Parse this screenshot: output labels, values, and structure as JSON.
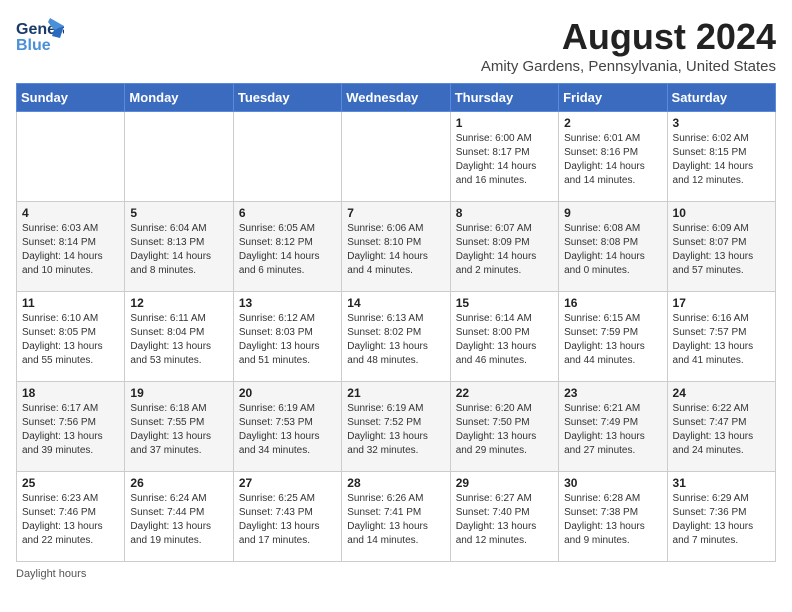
{
  "logo": {
    "general": "General",
    "blue": "Blue"
  },
  "title": "August 2024",
  "subtitle": "Amity Gardens, Pennsylvania, United States",
  "days_of_week": [
    "Sunday",
    "Monday",
    "Tuesday",
    "Wednesday",
    "Thursday",
    "Friday",
    "Saturday"
  ],
  "weeks": [
    [
      {
        "day": "",
        "info": ""
      },
      {
        "day": "",
        "info": ""
      },
      {
        "day": "",
        "info": ""
      },
      {
        "day": "",
        "info": ""
      },
      {
        "day": "1",
        "info": "Sunrise: 6:00 AM\nSunset: 8:17 PM\nDaylight: 14 hours\nand 16 minutes."
      },
      {
        "day": "2",
        "info": "Sunrise: 6:01 AM\nSunset: 8:16 PM\nDaylight: 14 hours\nand 14 minutes."
      },
      {
        "day": "3",
        "info": "Sunrise: 6:02 AM\nSunset: 8:15 PM\nDaylight: 14 hours\nand 12 minutes."
      }
    ],
    [
      {
        "day": "4",
        "info": "Sunrise: 6:03 AM\nSunset: 8:14 PM\nDaylight: 14 hours\nand 10 minutes."
      },
      {
        "day": "5",
        "info": "Sunrise: 6:04 AM\nSunset: 8:13 PM\nDaylight: 14 hours\nand 8 minutes."
      },
      {
        "day": "6",
        "info": "Sunrise: 6:05 AM\nSunset: 8:12 PM\nDaylight: 14 hours\nand 6 minutes."
      },
      {
        "day": "7",
        "info": "Sunrise: 6:06 AM\nSunset: 8:10 PM\nDaylight: 14 hours\nand 4 minutes."
      },
      {
        "day": "8",
        "info": "Sunrise: 6:07 AM\nSunset: 8:09 PM\nDaylight: 14 hours\nand 2 minutes."
      },
      {
        "day": "9",
        "info": "Sunrise: 6:08 AM\nSunset: 8:08 PM\nDaylight: 14 hours\nand 0 minutes."
      },
      {
        "day": "10",
        "info": "Sunrise: 6:09 AM\nSunset: 8:07 PM\nDaylight: 13 hours\nand 57 minutes."
      }
    ],
    [
      {
        "day": "11",
        "info": "Sunrise: 6:10 AM\nSunset: 8:05 PM\nDaylight: 13 hours\nand 55 minutes."
      },
      {
        "day": "12",
        "info": "Sunrise: 6:11 AM\nSunset: 8:04 PM\nDaylight: 13 hours\nand 53 minutes."
      },
      {
        "day": "13",
        "info": "Sunrise: 6:12 AM\nSunset: 8:03 PM\nDaylight: 13 hours\nand 51 minutes."
      },
      {
        "day": "14",
        "info": "Sunrise: 6:13 AM\nSunset: 8:02 PM\nDaylight: 13 hours\nand 48 minutes."
      },
      {
        "day": "15",
        "info": "Sunrise: 6:14 AM\nSunset: 8:00 PM\nDaylight: 13 hours\nand 46 minutes."
      },
      {
        "day": "16",
        "info": "Sunrise: 6:15 AM\nSunset: 7:59 PM\nDaylight: 13 hours\nand 44 minutes."
      },
      {
        "day": "17",
        "info": "Sunrise: 6:16 AM\nSunset: 7:57 PM\nDaylight: 13 hours\nand 41 minutes."
      }
    ],
    [
      {
        "day": "18",
        "info": "Sunrise: 6:17 AM\nSunset: 7:56 PM\nDaylight: 13 hours\nand 39 minutes."
      },
      {
        "day": "19",
        "info": "Sunrise: 6:18 AM\nSunset: 7:55 PM\nDaylight: 13 hours\nand 37 minutes."
      },
      {
        "day": "20",
        "info": "Sunrise: 6:19 AM\nSunset: 7:53 PM\nDaylight: 13 hours\nand 34 minutes."
      },
      {
        "day": "21",
        "info": "Sunrise: 6:19 AM\nSunset: 7:52 PM\nDaylight: 13 hours\nand 32 minutes."
      },
      {
        "day": "22",
        "info": "Sunrise: 6:20 AM\nSunset: 7:50 PM\nDaylight: 13 hours\nand 29 minutes."
      },
      {
        "day": "23",
        "info": "Sunrise: 6:21 AM\nSunset: 7:49 PM\nDaylight: 13 hours\nand 27 minutes."
      },
      {
        "day": "24",
        "info": "Sunrise: 6:22 AM\nSunset: 7:47 PM\nDaylight: 13 hours\nand 24 minutes."
      }
    ],
    [
      {
        "day": "25",
        "info": "Sunrise: 6:23 AM\nSunset: 7:46 PM\nDaylight: 13 hours\nand 22 minutes."
      },
      {
        "day": "26",
        "info": "Sunrise: 6:24 AM\nSunset: 7:44 PM\nDaylight: 13 hours\nand 19 minutes."
      },
      {
        "day": "27",
        "info": "Sunrise: 6:25 AM\nSunset: 7:43 PM\nDaylight: 13 hours\nand 17 minutes."
      },
      {
        "day": "28",
        "info": "Sunrise: 6:26 AM\nSunset: 7:41 PM\nDaylight: 13 hours\nand 14 minutes."
      },
      {
        "day": "29",
        "info": "Sunrise: 6:27 AM\nSunset: 7:40 PM\nDaylight: 13 hours\nand 12 minutes."
      },
      {
        "day": "30",
        "info": "Sunrise: 6:28 AM\nSunset: 7:38 PM\nDaylight: 13 hours\nand 9 minutes."
      },
      {
        "day": "31",
        "info": "Sunrise: 6:29 AM\nSunset: 7:36 PM\nDaylight: 13 hours\nand 7 minutes."
      }
    ]
  ],
  "footer": "Daylight hours"
}
